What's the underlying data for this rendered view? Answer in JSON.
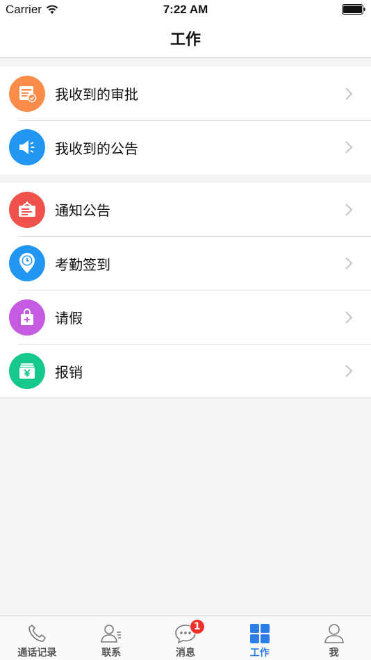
{
  "status_bar": {
    "carrier": "Carrier",
    "time": "7:22 AM"
  },
  "nav": {
    "title": "工作"
  },
  "group1": [
    {
      "label": "我收到的审批",
      "icon": "approval-icon",
      "color": "#fb8c4a"
    },
    {
      "label": "我收到的公告",
      "icon": "megaphone-icon",
      "color": "#2196f3"
    }
  ],
  "group2": [
    {
      "label": "通知公告",
      "icon": "notice-board-icon",
      "color": "#f0534b"
    },
    {
      "label": "考勤签到",
      "icon": "clock-pin-icon",
      "color": "#2196f3"
    },
    {
      "label": "请假",
      "icon": "bag-icon",
      "color": "#c45be0"
    },
    {
      "label": "报销",
      "icon": "yen-icon",
      "color": "#17c88b"
    }
  ],
  "tabs": [
    {
      "label": "通话记录",
      "icon": "phone-icon"
    },
    {
      "label": "联系",
      "icon": "contacts-icon"
    },
    {
      "label": "消息",
      "icon": "chat-icon",
      "badge": "1"
    },
    {
      "label": "工作",
      "icon": "grid-icon",
      "active": true
    },
    {
      "label": "我",
      "icon": "user-icon"
    }
  ],
  "colors": {
    "accent": "#2a7ee6",
    "badge": "#f0312a"
  }
}
